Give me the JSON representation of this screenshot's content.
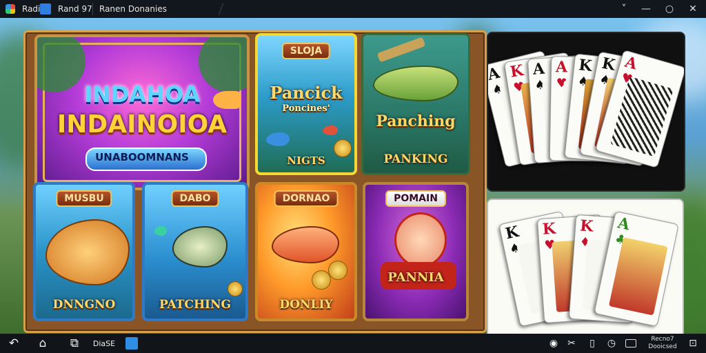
{
  "window": {
    "title_left": "Radi",
    "tab1_label": "Rand 97",
    "tab2_label": "Ranen Donanies",
    "minimize_glyph": "˅",
    "restore_glyph": "—",
    "maximize_glyph": "○",
    "close_glyph": "✕"
  },
  "tiles": {
    "hero": {
      "title_line1": "INDAHOA",
      "title_line2": "INDAINOIOA",
      "subtitle": "UNABOOMNANS"
    },
    "top1": {
      "ribbon": "SLOJA",
      "title": "Pancick",
      "subtitle": "Poncines'",
      "caption": "NIGTS"
    },
    "top2": {
      "title": "Panching",
      "caption": "PANKING"
    },
    "bottom1": {
      "ribbon": "MUSBU",
      "caption": "DNNGNO"
    },
    "bottom2": {
      "ribbon": "DABO",
      "caption": "PATCHING"
    },
    "bottom3": {
      "ribbon": "DORNAO",
      "caption": "DONLIY"
    },
    "bottom4": {
      "ribbon": "POMAIN",
      "caption": "PANNIA"
    }
  },
  "cards_dark": [
    {
      "rank": "A",
      "suit": "♠",
      "color": "#111111"
    },
    {
      "rank": "K",
      "suit": "♥",
      "color": "#c8102e"
    },
    {
      "rank": "A",
      "suit": "♠",
      "color": "#111111"
    },
    {
      "rank": "A",
      "suit": "♥",
      "color": "#c8102e"
    },
    {
      "rank": "K",
      "suit": "♠",
      "color": "#111111"
    },
    {
      "rank": "K",
      "suit": "♠",
      "color": "#111111"
    },
    {
      "rank": "A",
      "suit": "♥",
      "color": "#c8102e"
    }
  ],
  "cards_light": [
    {
      "rank": "K",
      "suit": "♠",
      "color": "#111111"
    },
    {
      "rank": "K",
      "suit": "♥",
      "color": "#c8102e"
    },
    {
      "rank": "K",
      "suit": "♦",
      "color": "#c8102e"
    },
    {
      "rank": "A",
      "suit": "♣",
      "color": "#2f8a1e"
    }
  ],
  "taskbar": {
    "back_glyph": "↶",
    "home_glyph": "⌂",
    "recent_glyph": "⧉",
    "label": "DiaSE",
    "status_line1": "Recno7",
    "status_line2": "Dooicsed"
  },
  "icons": {
    "eye": "◉",
    "scissors": "✂",
    "phone": "▯",
    "clock": "◷",
    "screen": "⊡"
  }
}
